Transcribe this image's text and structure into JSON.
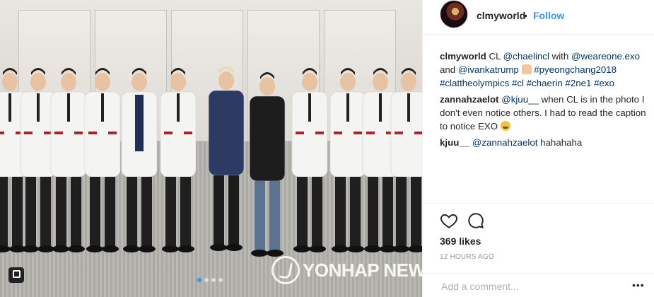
{
  "post": {
    "username": "clmyworld",
    "follow_label": "Follow",
    "separator": "•"
  },
  "comments": [
    {
      "author": "clmyworld",
      "parts": [
        {
          "t": "text",
          "v": "CL "
        },
        {
          "t": "link",
          "v": "@chaelincl"
        },
        {
          "t": "text",
          "v": " with "
        },
        {
          "t": "link",
          "v": "@weareone.exo"
        },
        {
          "t": "text",
          "v": " and "
        },
        {
          "t": "link",
          "v": "@ivankatrump"
        },
        {
          "t": "text",
          "v": " "
        },
        {
          "t": "emoji",
          "v": "folded-hands-emoji"
        },
        {
          "t": "text",
          "v": " "
        },
        {
          "t": "link",
          "v": "#pyeongchang2018"
        },
        {
          "t": "text",
          "v": " "
        },
        {
          "t": "link",
          "v": "#clattheolympics"
        },
        {
          "t": "text",
          "v": " "
        },
        {
          "t": "link",
          "v": "#cl"
        },
        {
          "t": "text",
          "v": " "
        },
        {
          "t": "link",
          "v": "#chaerin"
        },
        {
          "t": "text",
          "v": " "
        },
        {
          "t": "link",
          "v": "#2ne1"
        },
        {
          "t": "text",
          "v": " "
        },
        {
          "t": "link",
          "v": "#exo"
        }
      ]
    },
    {
      "author": "zannahzaelot",
      "parts": [
        {
          "t": "link",
          "v": "@kjuu__"
        },
        {
          "t": "text",
          "v": " when CL is in the photo I don't even notice others. I had to read the caption to notice EXO "
        },
        {
          "t": "emoji",
          "v": "grinning-sweat-emoji"
        }
      ]
    },
    {
      "author": "kjuu__",
      "parts": [
        {
          "t": "link",
          "v": "@zannahzaelot"
        },
        {
          "t": "text",
          "v": " hahahaha"
        }
      ]
    }
  ],
  "likes": "369 likes",
  "timestamp": "12 HOURS AGO",
  "add_comment_placeholder": "Add a comment...",
  "more_label": "•••",
  "media": {
    "watermark": "YONHAP NEW",
    "carousel_dots": 4,
    "active_dot": 0
  },
  "colors": {
    "link": "#003569",
    "follow": "#3897f0",
    "text": "#262626",
    "muted": "#999999"
  }
}
